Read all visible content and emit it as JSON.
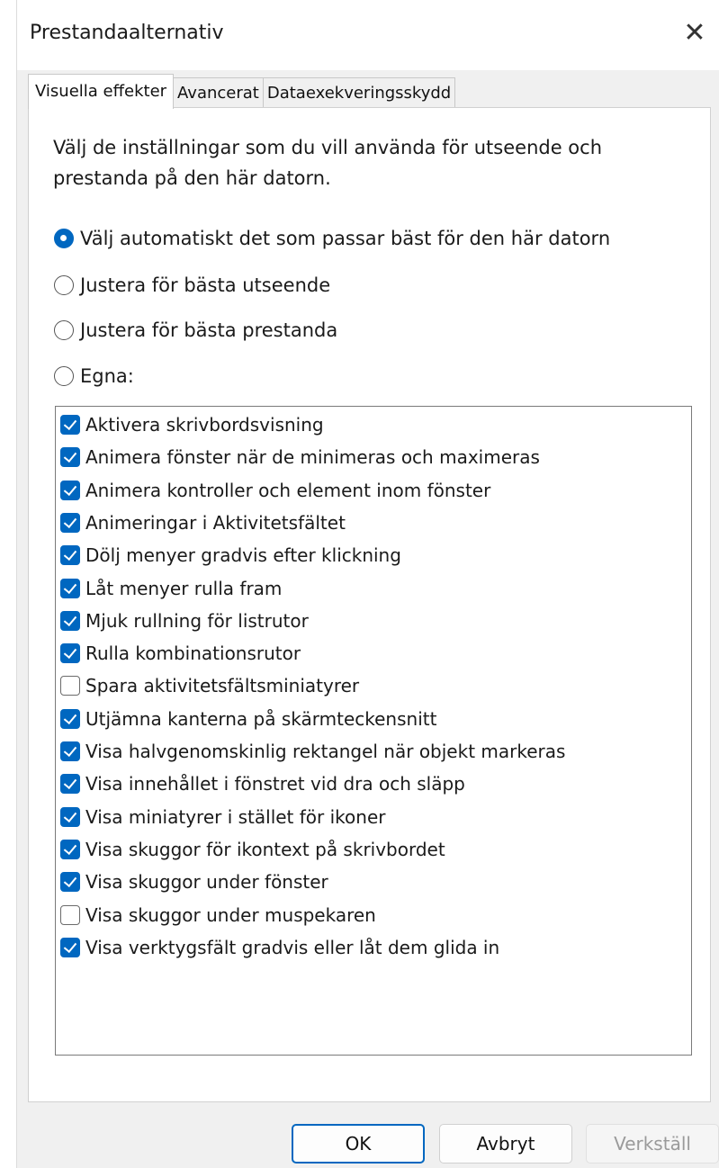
{
  "window": {
    "title": "Prestandaalternativ",
    "close_icon": "close-icon"
  },
  "tabs": [
    {
      "label": "Visuella effekter",
      "active": true
    },
    {
      "label": "Avancerat",
      "active": false
    },
    {
      "label": "Dataexekveringsskydd",
      "active": false
    }
  ],
  "intro": "Välj de inställningar som du vill använda för utseende och prestanda på den här datorn.",
  "radios": [
    {
      "label": "Välj automatiskt det som passar bäst för den här datorn",
      "checked": true
    },
    {
      "label": "Justera för bästa utseende",
      "checked": false
    },
    {
      "label": "Justera för bästa prestanda",
      "checked": false
    },
    {
      "label": "Egna:",
      "checked": false
    }
  ],
  "effects": [
    {
      "label": "Aktivera skrivbordsvisning",
      "checked": true
    },
    {
      "label": "Animera fönster när de minimeras och maximeras",
      "checked": true
    },
    {
      "label": "Animera kontroller och element inom fönster",
      "checked": true
    },
    {
      "label": "Animeringar i Aktivitetsfältet",
      "checked": true
    },
    {
      "label": "Dölj menyer gradvis efter klickning",
      "checked": true
    },
    {
      "label": "Låt menyer rulla fram",
      "checked": true
    },
    {
      "label": "Mjuk rullning för listrutor",
      "checked": true
    },
    {
      "label": "Rulla kombinationsrutor",
      "checked": true
    },
    {
      "label": "Spara aktivitetsfältsminiatyrer",
      "checked": false
    },
    {
      "label": "Utjämna kanterna på skärmteckensnitt",
      "checked": true
    },
    {
      "label": "Visa halvgenomskinlig rektangel när objekt markeras",
      "checked": true
    },
    {
      "label": "Visa innehållet i fönstret vid dra och släpp",
      "checked": true
    },
    {
      "label": "Visa miniatyrer i stället för ikoner",
      "checked": true
    },
    {
      "label": "Visa skuggor för ikontext på skrivbordet",
      "checked": true
    },
    {
      "label": "Visa skuggor under fönster",
      "checked": true
    },
    {
      "label": "Visa skuggor under muspekaren",
      "checked": false
    },
    {
      "label": "Visa verktygsfält gradvis eller låt dem glida in",
      "checked": true
    }
  ],
  "buttons": {
    "ok": "OK",
    "cancel": "Avbryt",
    "apply": "Verkställ"
  },
  "colors": {
    "accent": "#0067c0"
  }
}
